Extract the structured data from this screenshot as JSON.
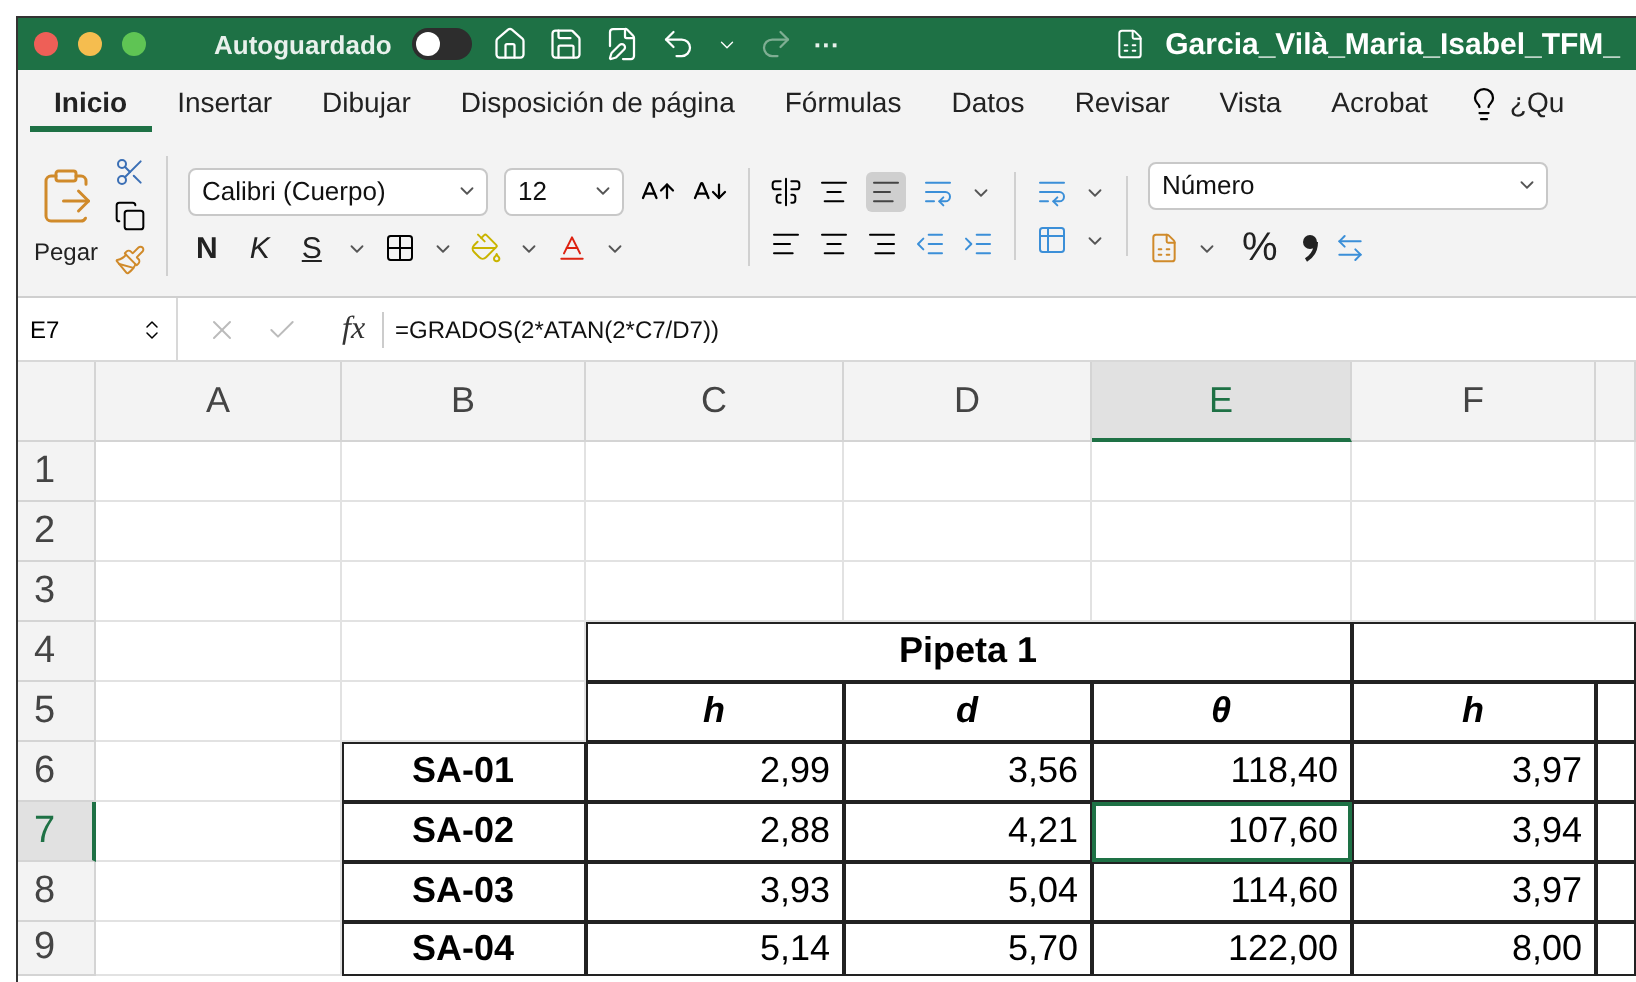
{
  "titlebar": {
    "autosave_label": "Autoguardado",
    "autosave_on": false,
    "more": "···",
    "file_name": "Garcia_Vilà_Maria_Isabel_TFM_"
  },
  "tabs": [
    {
      "label": "Inicio",
      "selected": true
    },
    {
      "label": "Insertar",
      "selected": false
    },
    {
      "label": "Dibujar",
      "selected": false
    },
    {
      "label": "Disposición de página",
      "selected": false
    },
    {
      "label": "Fórmulas",
      "selected": false
    },
    {
      "label": "Datos",
      "selected": false
    },
    {
      "label": "Revisar",
      "selected": false
    },
    {
      "label": "Vista",
      "selected": false
    },
    {
      "label": "Acrobat",
      "selected": false
    }
  ],
  "tell_me": "¿Qu",
  "ribbon": {
    "paste_label": "Pegar",
    "font_name": "Calibri (Cuerpo)",
    "font_size": "12",
    "bold": "N",
    "italic": "K",
    "underline": "S",
    "number_format": "Número",
    "percent": "%"
  },
  "formula_bar": {
    "name_box": "E7",
    "fx": "fx",
    "formula": "=GRADOS(2*ATAN(2*C7/D7))"
  },
  "columns": [
    {
      "label": "A",
      "selected": false
    },
    {
      "label": "B",
      "selected": false
    },
    {
      "label": "C",
      "selected": false
    },
    {
      "label": "D",
      "selected": false
    },
    {
      "label": "E",
      "selected": true
    },
    {
      "label": "F",
      "selected": false
    }
  ],
  "rows": [
    {
      "number": "1",
      "selected": false,
      "kind": "blank"
    },
    {
      "number": "2",
      "selected": false,
      "kind": "blank"
    },
    {
      "number": "3",
      "selected": false,
      "kind": "blank"
    },
    {
      "number": "4",
      "selected": false,
      "kind": "group",
      "group_label": "Pipeta 1"
    },
    {
      "number": "5",
      "selected": false,
      "kind": "subheader",
      "labels": [
        "h",
        "d",
        "θ",
        "h"
      ]
    },
    {
      "number": "6",
      "selected": false,
      "kind": "data",
      "sample": "SA-01",
      "values": [
        {
          "text": "2,99",
          "selected": false
        },
        {
          "text": "3,56",
          "selected": false
        },
        {
          "text": "118,40",
          "selected": false
        },
        {
          "text": "3,97",
          "selected": false
        }
      ]
    },
    {
      "number": "7",
      "selected": true,
      "kind": "data",
      "sample": "SA-02",
      "values": [
        {
          "text": "2,88",
          "selected": false
        },
        {
          "text": "4,21",
          "selected": false
        },
        {
          "text": "107,60",
          "selected": true
        },
        {
          "text": "3,94",
          "selected": false
        }
      ]
    },
    {
      "number": "8",
      "selected": false,
      "kind": "data",
      "sample": "SA-03",
      "values": [
        {
          "text": "3,93",
          "selected": false
        },
        {
          "text": "5,04",
          "selected": false
        },
        {
          "text": "114,60",
          "selected": false
        },
        {
          "text": "3,97",
          "selected": false
        }
      ]
    },
    {
      "number": "9",
      "selected": false,
      "kind": "data",
      "sample": "SA-04",
      "values": [
        {
          "text": "5,14",
          "selected": false
        },
        {
          "text": "5,70",
          "selected": false
        },
        {
          "text": "122,00",
          "selected": false
        },
        {
          "text": "8,00",
          "selected": false
        }
      ]
    }
  ]
}
